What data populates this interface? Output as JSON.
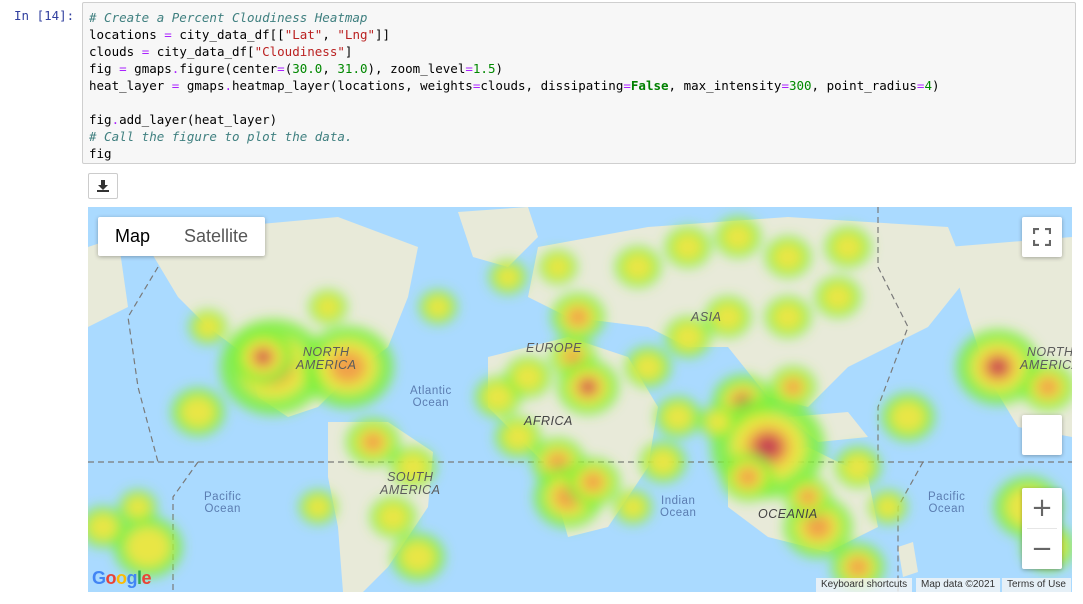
{
  "cell": {
    "prompt": "In [14]:",
    "code": [
      [
        {
          "t": "# Create a Percent Cloudiness Heatmap",
          "c": "cm"
        }
      ],
      [
        {
          "t": "locations "
        },
        {
          "t": "=",
          "c": "op"
        },
        {
          "t": " city_data_df[["
        },
        {
          "t": "\"Lat\"",
          "c": "st"
        },
        {
          "t": ", "
        },
        {
          "t": "\"Lng\"",
          "c": "st"
        },
        {
          "t": "]]"
        }
      ],
      [
        {
          "t": "clouds "
        },
        {
          "t": "=",
          "c": "op"
        },
        {
          "t": " city_data_df["
        },
        {
          "t": "\"Cloudiness\"",
          "c": "st"
        },
        {
          "t": "]"
        }
      ],
      [
        {
          "t": "fig "
        },
        {
          "t": "=",
          "c": "op"
        },
        {
          "t": " gmaps"
        },
        {
          "t": ".",
          "c": "op"
        },
        {
          "t": "figure(center"
        },
        {
          "t": "=",
          "c": "op"
        },
        {
          "t": "("
        },
        {
          "t": "30.0",
          "c": "nu"
        },
        {
          "t": ", "
        },
        {
          "t": "31.0",
          "c": "nu"
        },
        {
          "t": "), zoom_level"
        },
        {
          "t": "=",
          "c": "op"
        },
        {
          "t": "1.5",
          "c": "nu"
        },
        {
          "t": ")"
        }
      ],
      [
        {
          "t": "heat_layer "
        },
        {
          "t": "=",
          "c": "op"
        },
        {
          "t": " gmaps"
        },
        {
          "t": ".",
          "c": "op"
        },
        {
          "t": "heatmap_layer(locations, weights"
        },
        {
          "t": "=",
          "c": "op"
        },
        {
          "t": "clouds, dissipating"
        },
        {
          "t": "=",
          "c": "op"
        },
        {
          "t": "False",
          "c": "kw"
        },
        {
          "t": ", max_intensity"
        },
        {
          "t": "=",
          "c": "op"
        },
        {
          "t": "300",
          "c": "nu"
        },
        {
          "t": ", point_radius"
        },
        {
          "t": "=",
          "c": "op"
        },
        {
          "t": "4",
          "c": "nu"
        },
        {
          "t": ")"
        }
      ],
      [
        {
          "t": ""
        }
      ],
      [
        {
          "t": "fig"
        },
        {
          "t": ".",
          "c": "op"
        },
        {
          "t": "add_layer(heat_layer)"
        }
      ],
      [
        {
          "t": "# Call the figure to plot the data.",
          "c": "cm"
        }
      ],
      [
        {
          "t": "fig"
        }
      ]
    ]
  },
  "toolbar": {
    "download_icon": "download-icon"
  },
  "map": {
    "type_buttons": {
      "map": "Map",
      "satellite": "Satellite"
    },
    "fullscreen_icon": "fullscreen-icon",
    "zoom_in": "+",
    "zoom_out": "−",
    "google_logo": "Google",
    "attribution": {
      "shortcuts": "Keyboard shortcuts",
      "map_data": "Map data ©2021",
      "terms": "Terms of Use"
    },
    "labels": {
      "north_america": "NORTH\nAMERICA",
      "north_america_2": "NORTH\nAMERICA",
      "europe": "EUROPE",
      "asia": "ASIA",
      "africa": "AFRICA",
      "south_america": "SOUTH\nAMERICA",
      "oceania": "OCEANIA",
      "atlantic": "Atlantic\nOcean",
      "pacific_1": "Pacific\nOcean",
      "pacific_2": "Pacific\nOcean",
      "indian": "Indian\nOcean"
    },
    "colors": {
      "water": "#aadaff",
      "land": "#e8ead9",
      "heat_low": "#7cf03b",
      "heat_mid": "#f5e642",
      "heat_high": "#c43a52"
    }
  }
}
